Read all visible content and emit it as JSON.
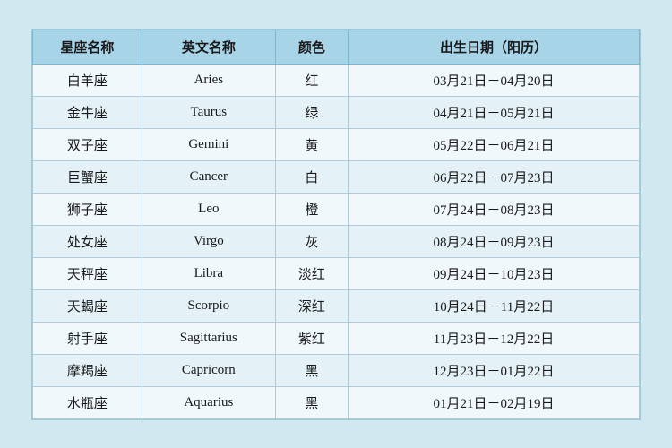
{
  "table": {
    "headers": {
      "chinese_name": "星座名称",
      "english_name": "英文名称",
      "color": "颜色",
      "birth_date": "出生日期（阳历）"
    },
    "rows": [
      {
        "chinese": "白羊座",
        "english": "Aries",
        "color": "红",
        "date": "03月21日－04月20日"
      },
      {
        "chinese": "金牛座",
        "english": "Taurus",
        "color": "绿",
        "date": "04月21日－05月21日"
      },
      {
        "chinese": "双子座",
        "english": "Gemini",
        "color": "黄",
        "date": "05月22日－06月21日"
      },
      {
        "chinese": "巨蟹座",
        "english": "Cancer",
        "color": "白",
        "date": "06月22日－07月23日"
      },
      {
        "chinese": "狮子座",
        "english": "Leo",
        "color": "橙",
        "date": "07月24日－08月23日"
      },
      {
        "chinese": "处女座",
        "english": "Virgo",
        "color": "灰",
        "date": "08月24日－09月23日"
      },
      {
        "chinese": "天秤座",
        "english": "Libra",
        "color": "淡红",
        "date": "09月24日－10月23日"
      },
      {
        "chinese": "天蝎座",
        "english": "Scorpio",
        "color": "深红",
        "date": "10月24日－11月22日"
      },
      {
        "chinese": "射手座",
        "english": "Sagittarius",
        "color": "紫红",
        "date": "11月23日－12月22日"
      },
      {
        "chinese": "摩羯座",
        "english": "Capricorn",
        "color": "黑",
        "date": "12月23日－01月22日"
      },
      {
        "chinese": "水瓶座",
        "english": "Aquarius",
        "color": "黑",
        "date": "01月21日－02月19日"
      }
    ]
  }
}
